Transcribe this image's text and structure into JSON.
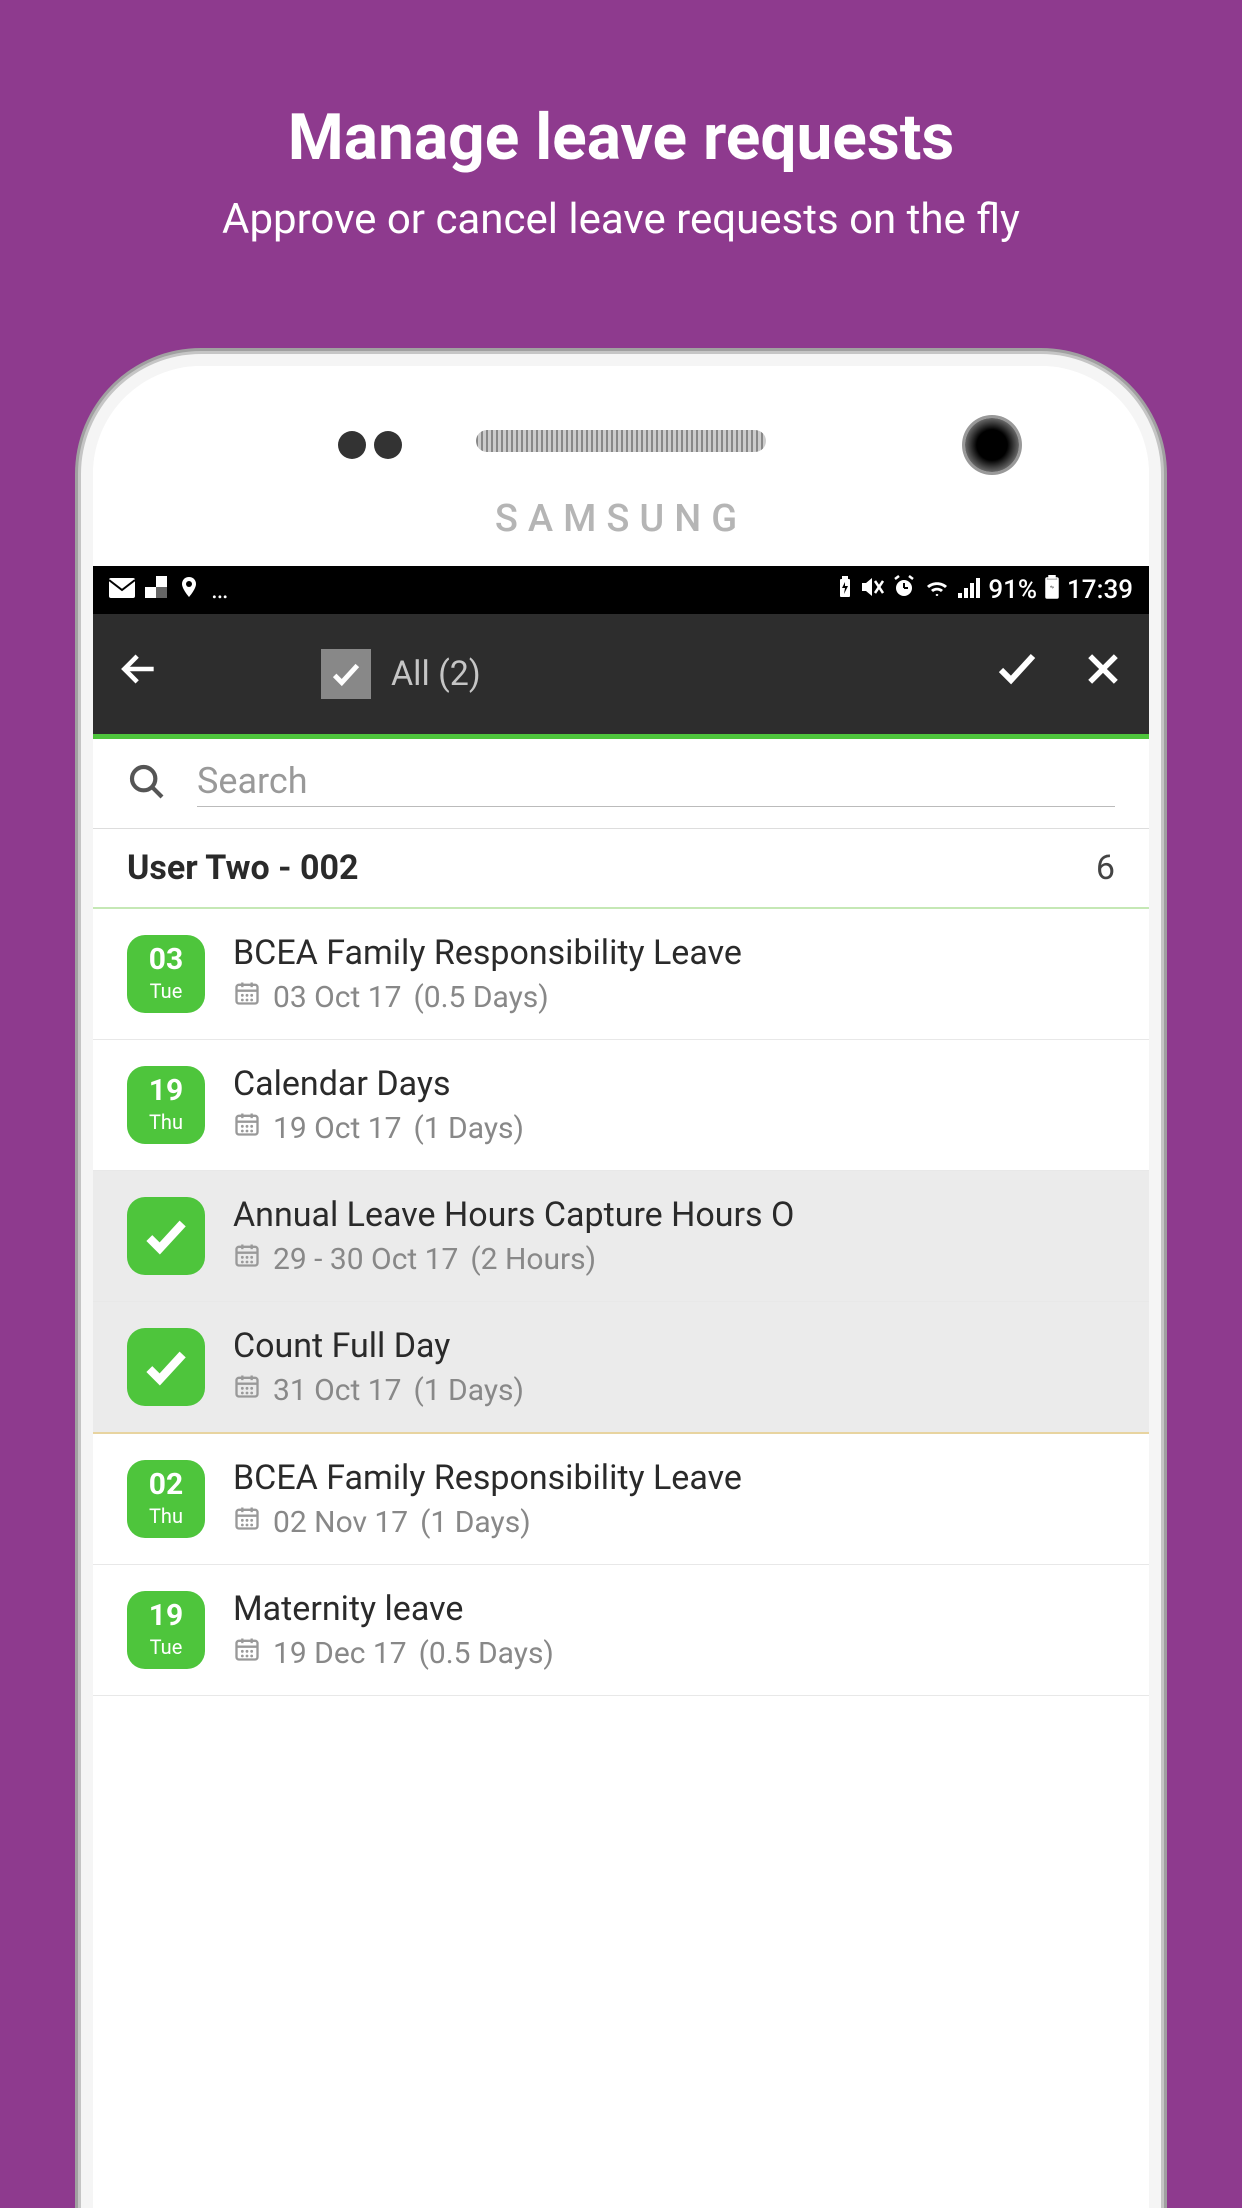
{
  "promo": {
    "heading": "Manage leave requests",
    "subheading": "Approve or cancel leave requests on the fly"
  },
  "phone": {
    "brand": "SAMSUNG"
  },
  "statusBar": {
    "batteryPct": "91%",
    "time": "17:39"
  },
  "actionBar": {
    "allLabel": "All (2)"
  },
  "search": {
    "placeholder": "Search"
  },
  "user": {
    "name": "User Two - 002",
    "count": "6"
  },
  "leaves": [
    {
      "selected": false,
      "day": "03",
      "dow": "Tue",
      "title": "BCEA Family Responsibility Leave",
      "date": "03 Oct 17",
      "duration": "(0.5 Days)",
      "monthDivider": false
    },
    {
      "selected": false,
      "day": "19",
      "dow": "Thu",
      "title": "Calendar Days",
      "date": "19 Oct 17",
      "duration": "(1 Days)",
      "monthDivider": false
    },
    {
      "selected": true,
      "title": "Annual Leave Hours Capture Hours O",
      "date": "29 - 30 Oct 17",
      "duration": "(2 Hours)",
      "monthDivider": false
    },
    {
      "selected": true,
      "title": "Count Full Day",
      "date": "31 Oct 17",
      "duration": "(1 Days)",
      "monthDivider": true
    },
    {
      "selected": false,
      "day": "02",
      "dow": "Thu",
      "title": "BCEA Family Responsibility Leave",
      "date": "02 Nov 17",
      "duration": "(1 Days)",
      "monthDivider": false
    },
    {
      "selected": false,
      "day": "19",
      "dow": "Tue",
      "title": "Maternity leave",
      "date": "19 Dec 17",
      "duration": "(0.5 Days)",
      "monthDivider": false
    }
  ]
}
